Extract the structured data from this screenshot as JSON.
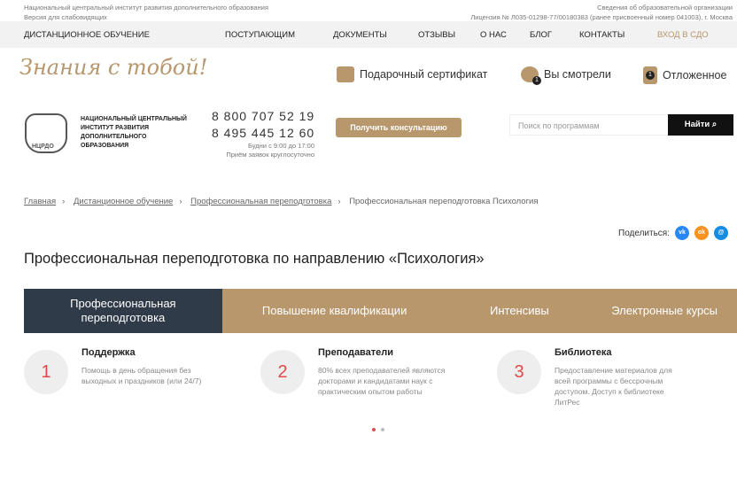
{
  "topbar": {
    "org_name": "Национальный центральный институт развития дополнительного образования",
    "accessibility": "Версия для слабовидящих",
    "edu_info": "Сведения об образовательной организации",
    "license": "Лицензия № Л035-01298-77/00180383 (ранее присвоенный номер 041003), г. Москва"
  },
  "nav": [
    "ДИСТАНЦИОННОЕ ОБУЧЕНИЕ",
    "ПОСТУПАЮЩИМ",
    "ДОКУМЕНТЫ",
    "ОТЗЫВЫ",
    "О НАС",
    "БЛОГ",
    "КОНТАКТЫ",
    "ВХОД В СДО"
  ],
  "header": {
    "slogan": "Знания с тобой!",
    "gift": "Подарочный сертификат",
    "viewed": "Вы смотрели",
    "viewed_count": "1",
    "saved": "Отложенное",
    "saved_count": "1"
  },
  "org": {
    "logo_text": "НЦРДО",
    "name": "НАЦИОНАЛЬНЫЙ ЦЕНТРАЛЬНЫЙ ИНСТИТУТ РАЗВИТИЯ ДОПОЛНИТЕЛЬНОГО ОБРАЗОВАНИЯ",
    "phone1": "8 800 707 52 19",
    "phone2": "8 495 445 12 60",
    "hours": "Будни с 9:00 до 17:00",
    "hours2": "Приём заявок круглосуточно",
    "consult": "Получить консультацию",
    "search_placeholder": "Поиск по программам",
    "search_btn": "Найти"
  },
  "breadcrumbs": [
    "Главная",
    "Дистанционное обучение",
    "Профессиональная переподготовка",
    "Профессиональная переподготовка Психология"
  ],
  "share": {
    "label": "Поделиться:",
    "icons": [
      "vk-icon",
      "ok-icon",
      "moimir-icon"
    ]
  },
  "title": "Профессиональная переподготовка по направлению «Психология»",
  "tabs": [
    {
      "label": "Профессиональная переподготовка",
      "active": true
    },
    {
      "label": "Повышение квалификации"
    },
    {
      "label": "Интенсивы"
    },
    {
      "label": "Электронные курсы"
    }
  ],
  "features": [
    {
      "num": "1",
      "title": "Поддержка",
      "desc": "Помощь в день обращения без выходных и праздников (или 24/7)"
    },
    {
      "num": "2",
      "title": "Преподаватели",
      "desc": "80% всех преподавателей являются докторами и кандидатами наук с практическим опытом работы"
    },
    {
      "num": "3",
      "title": "Библиотека",
      "desc": "Предоставление материалов для всей программы с бессрочным доступом. Доступ к библиотеке ЛитРес"
    }
  ],
  "colors": {
    "accent": "#b8976d",
    "dark": "#2f3b48",
    "number": "#e04a4a"
  }
}
